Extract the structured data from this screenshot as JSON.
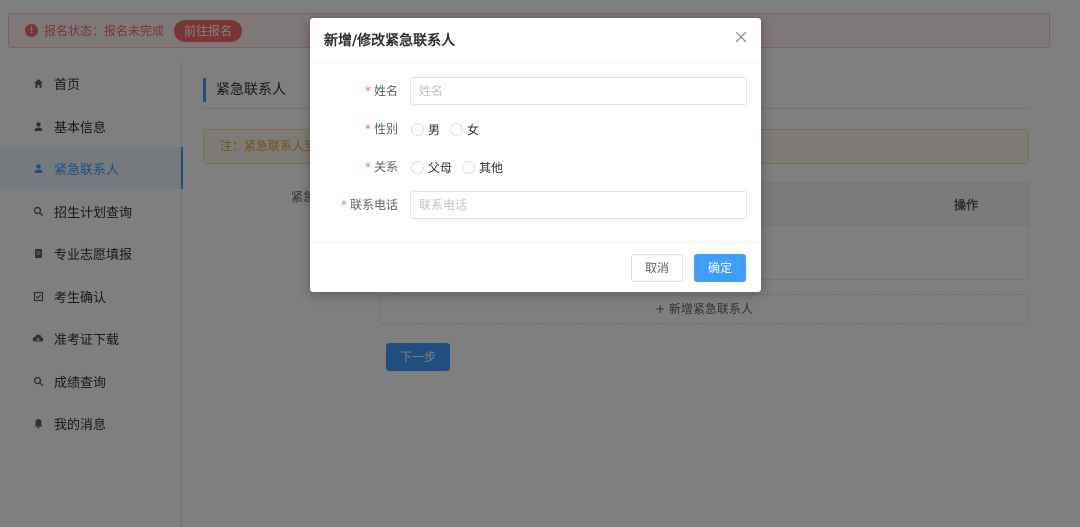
{
  "status": {
    "text": "报名状态：报名未完成",
    "button": "前往报名",
    "icon": "exclamation-circle-icon"
  },
  "sidebar": {
    "items": [
      {
        "label": "首页",
        "icon": "home-icon"
      },
      {
        "label": "基本信息",
        "icon": "user-icon"
      },
      {
        "label": "紧急联系人",
        "icon": "user-icon",
        "active": true
      },
      {
        "label": "招生计划查询",
        "icon": "search-icon"
      },
      {
        "label": "专业志愿填报",
        "icon": "document-icon"
      },
      {
        "label": "考生确认",
        "icon": "checkbox-icon"
      },
      {
        "label": "准考证下载",
        "icon": "cloud-download-icon"
      },
      {
        "label": "成绩查询",
        "icon": "search-icon"
      },
      {
        "label": "我的消息",
        "icon": "bell-icon"
      }
    ]
  },
  "main": {
    "title": "紧急联系人",
    "note": "注：紧急联系人至",
    "contact_label": "紧急",
    "table_operation_header": "操作",
    "add_button": "+ 新增紧急联系人",
    "next_button": "下一步"
  },
  "dialog": {
    "title": "新增/修改紧急联系人",
    "close_icon": "close-icon",
    "required_mark": "*",
    "name_label": "姓名",
    "name_placeholder": "姓名",
    "gender_label": "性别",
    "gender_options": [
      "男",
      "女"
    ],
    "relation_label": "关系",
    "relation_options": [
      "父母",
      "其他"
    ],
    "phone_label": "联系电话",
    "phone_placeholder": "联系电话",
    "cancel": "取消",
    "confirm": "确定"
  },
  "colors": {
    "primary": "#409eff",
    "danger": "#f56c6c",
    "warning": "#e6a23c"
  }
}
